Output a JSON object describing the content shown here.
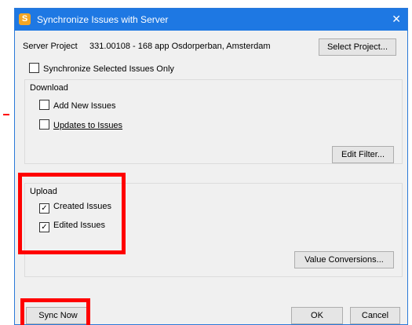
{
  "window": {
    "title": "Synchronize Issues with Server",
    "app_icon_letter": "S",
    "close_glyph": "✕"
  },
  "server": {
    "label": "Server Project",
    "project": "331.00108 - 168 app Osdorperban, Amsterdam",
    "select_button": "Select Project..."
  },
  "sync_selected_only": {
    "label": "Synchronize Selected Issues Only",
    "checked": false
  },
  "download": {
    "title": "Download",
    "add_new": {
      "label": "Add New Issues",
      "checked": false
    },
    "updates": {
      "label": "Updates to Issues",
      "checked": false
    },
    "edit_filter_button": "Edit Filter..."
  },
  "upload": {
    "title": "Upload",
    "created": {
      "label": "Created Issues",
      "checked": true
    },
    "edited": {
      "label": "Edited Issues",
      "checked": true
    },
    "value_conversions_button": "Value Conversions..."
  },
  "footer": {
    "sync_now": "Sync Now",
    "ok": "OK",
    "cancel": "Cancel"
  },
  "colors": {
    "titlebar": "#1e78e3",
    "highlight": "#ff0000"
  }
}
